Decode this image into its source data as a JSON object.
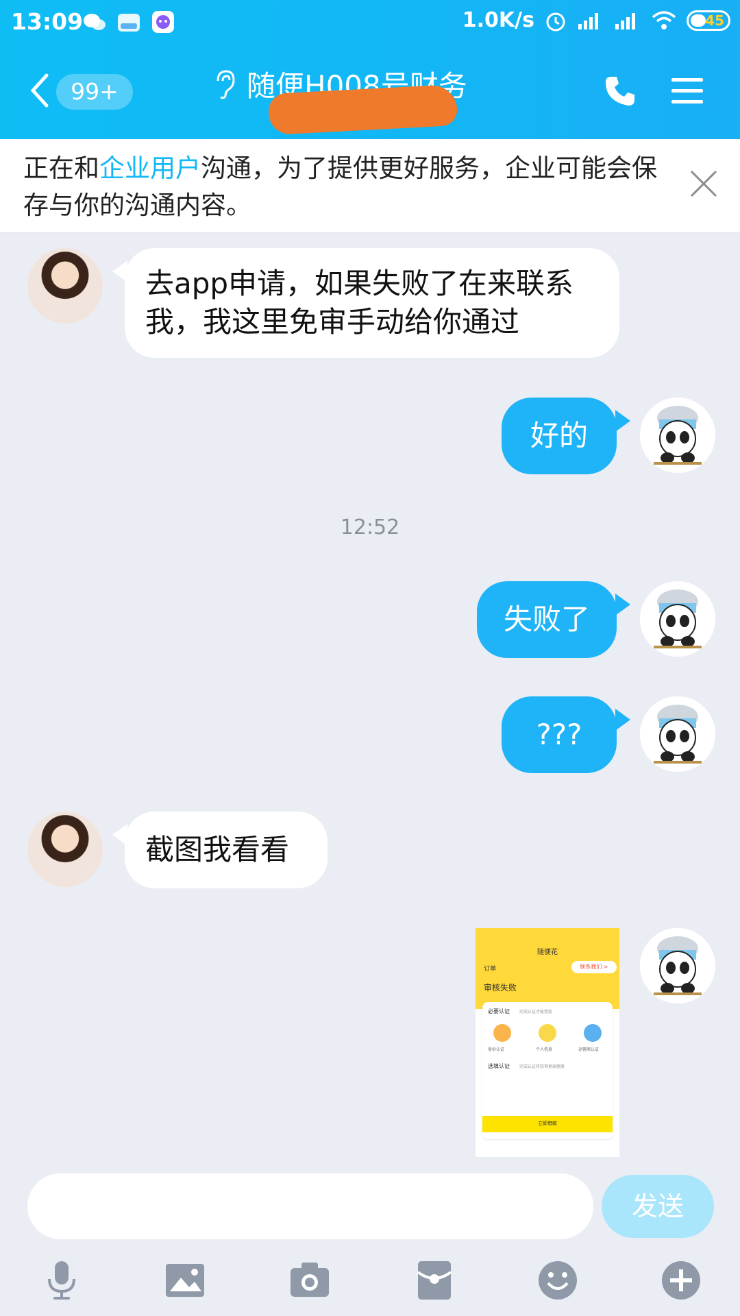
{
  "status_bar": {
    "time": "13:09",
    "speed": "1.0K/s",
    "battery": "45"
  },
  "header": {
    "unread_count": "99+",
    "title": "随便H008号财务"
  },
  "notice": {
    "prefix": "正在和",
    "highlight": "企业用户",
    "suffix": "沟通，为了提供更好服务，企业可能会保存与你的沟通内容。"
  },
  "messages": [
    {
      "side": "left",
      "text": "去app申请，如果失败了在来联系我，我这里免审手动给你通过"
    },
    {
      "side": "right",
      "text": "好的"
    },
    {
      "side": "right",
      "text": "失败了"
    },
    {
      "side": "right",
      "text": "???"
    },
    {
      "side": "left",
      "text": "截图我看看"
    }
  ],
  "timestamp": "12:52",
  "screenshot_thumb": {
    "app_name": "随便花",
    "order_label": "订单",
    "contact_label": "联系我们 >",
    "status_title": "审核失败",
    "required_label": "必要认证",
    "required_hint": "完成认证才能借款",
    "items": [
      "身份认证",
      "个人信息",
      "运营商认证"
    ],
    "optional_label": "选填认证",
    "optional_hint": "完成认证将获得更高额度",
    "button": "立即借款"
  },
  "input": {
    "placeholder": "",
    "send_label": "发送"
  },
  "toolbar_icons": [
    "microphone-icon",
    "image-icon",
    "camera-icon",
    "red-packet-icon",
    "emoji-icon",
    "plus-icon"
  ]
}
